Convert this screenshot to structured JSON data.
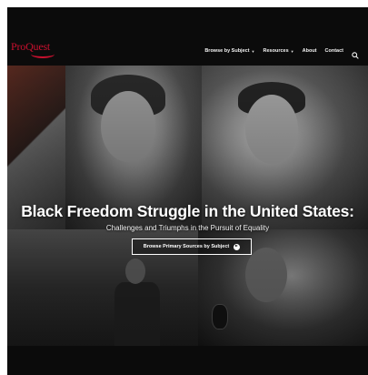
{
  "logo": {
    "text": "ProQuest",
    "color": "#c8102e"
  },
  "nav": {
    "items": [
      {
        "label": "Browse by Subject",
        "has_dropdown": true
      },
      {
        "label": "Resources",
        "has_dropdown": true
      },
      {
        "label": "About",
        "has_dropdown": false
      },
      {
        "label": "Contact",
        "has_dropdown": false
      }
    ],
    "search_icon": "search-icon"
  },
  "hero": {
    "title": "Black Freedom Struggle in the United States:",
    "subtitle": "Challenges and Triumphs in the Pursuit of Equality",
    "cta_label": "Browse Primary Sources by Subject",
    "cta_icon": "play-circle-icon"
  },
  "colors": {
    "background": "#0b0b0b",
    "text": "#ffffff",
    "accent": "#c8102e"
  }
}
